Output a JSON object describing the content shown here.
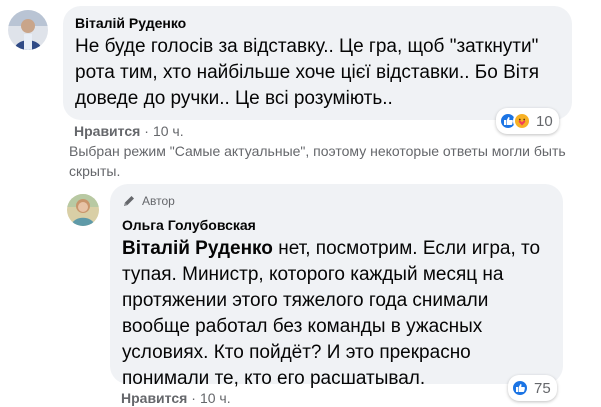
{
  "comment1": {
    "author": "Віталій Руденко",
    "text": "Не буде голосів за відставку.. Це гра, щоб \"заткнути\" рота тим, хто найбільше хоче цієї відставки.. Бо Вітя доведе до ручки.. Це всі розуміють..",
    "like_label": "Нравится",
    "time": "10 ч.",
    "reactions": [
      "like",
      "care"
    ],
    "reaction_count": "10"
  },
  "notice": "Выбран режим \"Самые актуальные\", поэтому некоторые ответы могли быть скрыты.",
  "reply": {
    "badge": "Автор",
    "author": "Ольга Голубовская",
    "mention": "Віталій Руденко",
    "text": " нет, посмотрим. Если игра, то тупая. Министр, которого каждый месяц на протяжении этого тяжелого года снимали вообще работал без команды в ужасных условиях. Кто пойдёт? И это прекрасно понимали те, кто его расшатывал.",
    "like_label": "Нравится",
    "time": "10 ч.",
    "reactions": [
      "like"
    ],
    "reaction_count": "75"
  },
  "colors": {
    "bubble": "#f0f2f5",
    "secondary_text": "#65676b",
    "like_blue": "#1b74e4",
    "care_yellow": "#f7b125"
  }
}
